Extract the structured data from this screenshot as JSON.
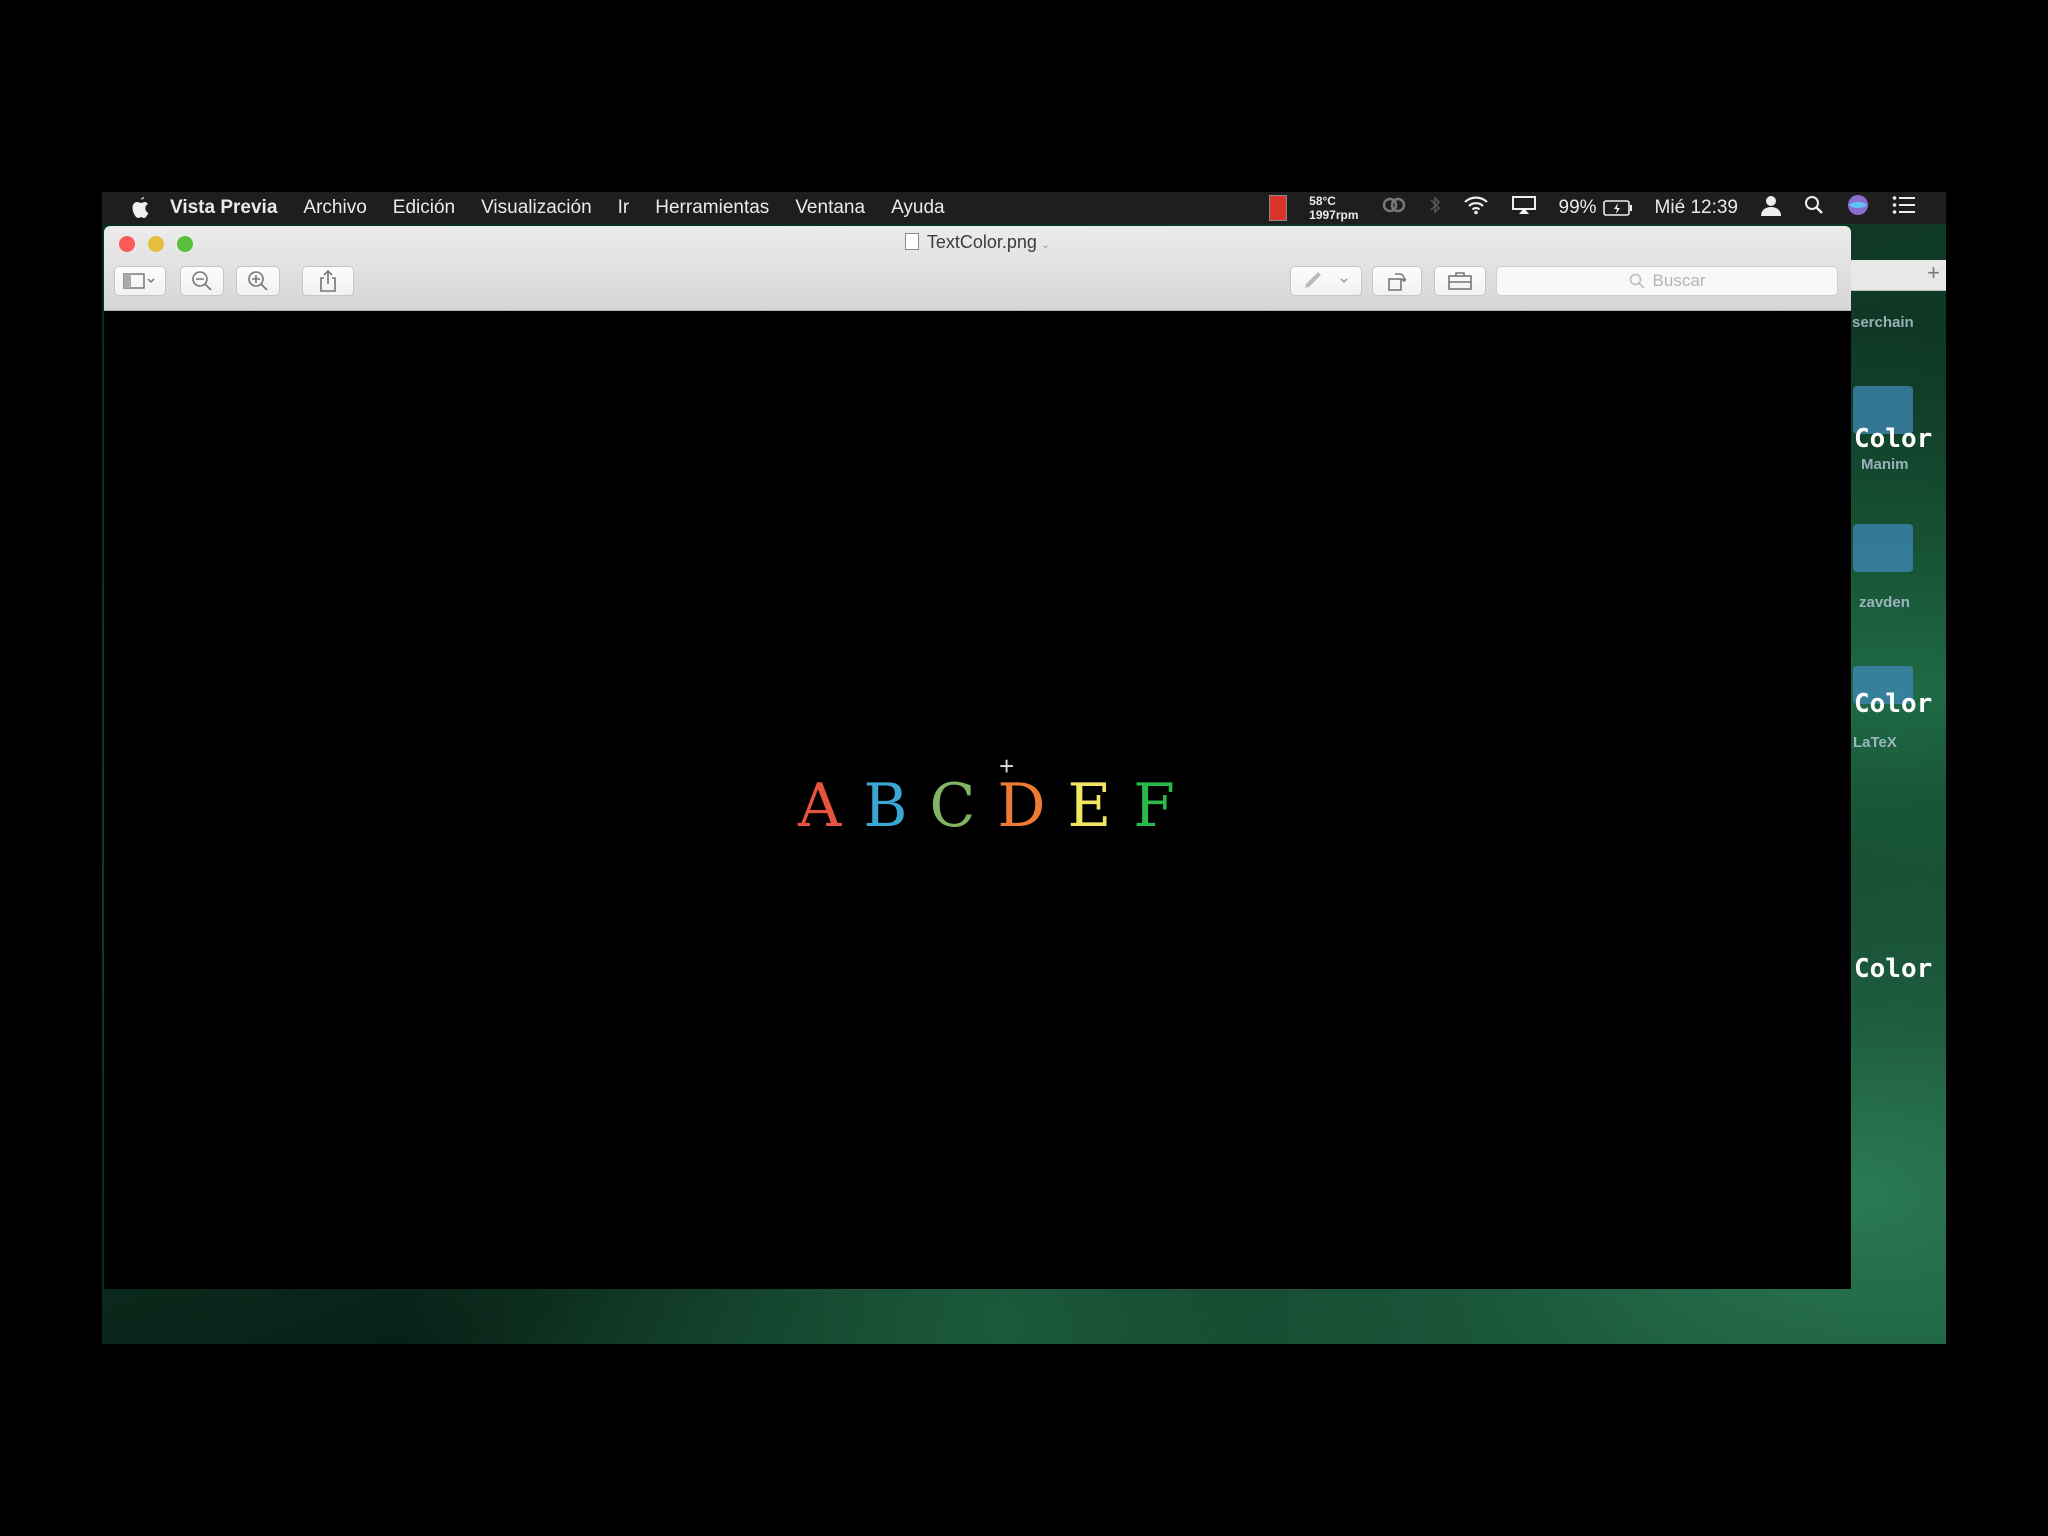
{
  "menubar": {
    "app_name": "Vista Previa",
    "items": [
      "Archivo",
      "Edición",
      "Visualización",
      "Ir",
      "Herramientas",
      "Ventana",
      "Ayuda"
    ],
    "temp": "58°C",
    "rpm": "1997rpm",
    "battery": "99%",
    "clock": "Mié 12:39"
  },
  "window": {
    "title": "TextColor.png",
    "search_placeholder": "Buscar"
  },
  "image": {
    "letters": [
      {
        "char": "A",
        "color": "#e8533f"
      },
      {
        "char": "B",
        "color": "#3aa6d3"
      },
      {
        "char": "C",
        "color": "#80b566"
      },
      {
        "char": "D",
        "color": "#ee7a36"
      },
      {
        "char": "E",
        "color": "#f2e561"
      },
      {
        "char": "F",
        "color": "#28b84c"
      }
    ]
  },
  "desktop": {
    "labels": [
      "serchain",
      "Manim",
      "zavden",
      "LaTeX"
    ],
    "color_labels": [
      "Color",
      "Color",
      "Color"
    ]
  }
}
